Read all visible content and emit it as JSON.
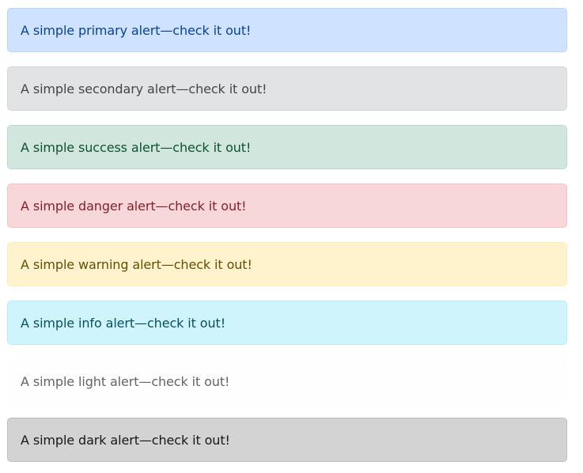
{
  "alerts": [
    {
      "variant": "primary",
      "text": "A simple primary alert—check it out!",
      "background": "#cfe2ff",
      "color": "#084298"
    },
    {
      "variant": "secondary",
      "text": "A simple secondary alert—check it out!",
      "background": "#e2e3e5",
      "color": "#41464b"
    },
    {
      "variant": "success",
      "text": "A simple success alert—check it out!",
      "background": "#d1e7dd",
      "color": "#0f5132"
    },
    {
      "variant": "danger",
      "text": "A simple danger alert—check it out!",
      "background": "#f8d7da",
      "color": "#842029"
    },
    {
      "variant": "warning",
      "text": "A simple warning alert—check it out!",
      "background": "#fff3cd",
      "color": "#664d03"
    },
    {
      "variant": "info",
      "text": "A simple info alert—check it out!",
      "background": "#cff4fc",
      "color": "#055160"
    },
    {
      "variant": "light",
      "text": "A simple light alert—check it out!",
      "background": "#fefefe",
      "color": "#636464"
    },
    {
      "variant": "dark",
      "text": "A simple dark alert—check it out!",
      "background": "#d3d3d4",
      "color": "#141619"
    }
  ]
}
